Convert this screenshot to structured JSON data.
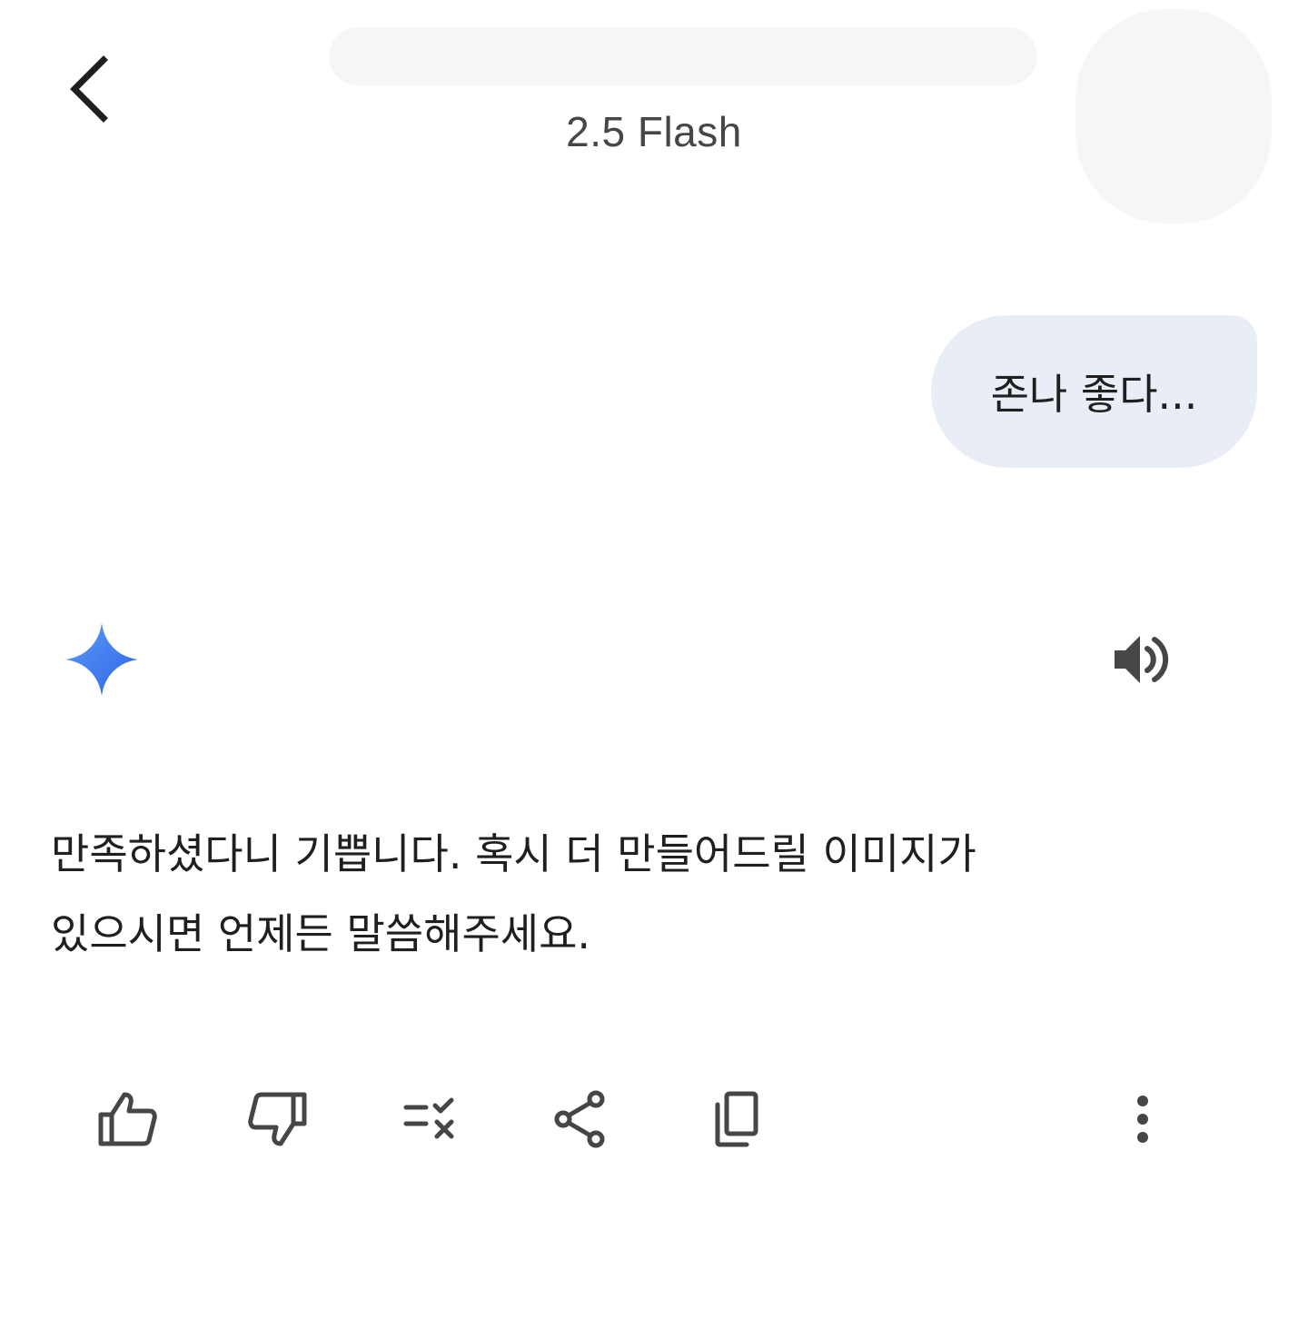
{
  "header": {
    "model_label": "2.5 Flash",
    "back_icon": "chevron-left-icon"
  },
  "conversation": {
    "user_message": "존나 좋다...",
    "assistant_icon": "gemini-spark-icon",
    "assistant_lines": [
      "만족하셨다니 기쁩니다. 혹시 더 만들어드릴 이미지가",
      "있으시면 언제든 말씀해주세요."
    ]
  },
  "actions": [
    {
      "name": "thumbs-up-icon"
    },
    {
      "name": "thumbs-down-icon"
    },
    {
      "name": "modify-response-icon"
    },
    {
      "name": "share-icon"
    },
    {
      "name": "copy-icon"
    },
    {
      "name": "more-vert-icon"
    }
  ],
  "colors": {
    "icon": "#444746",
    "bubble": "#e9eef6",
    "spark_start": "#4b8ff7",
    "spark_end": "#2f6ce8"
  }
}
